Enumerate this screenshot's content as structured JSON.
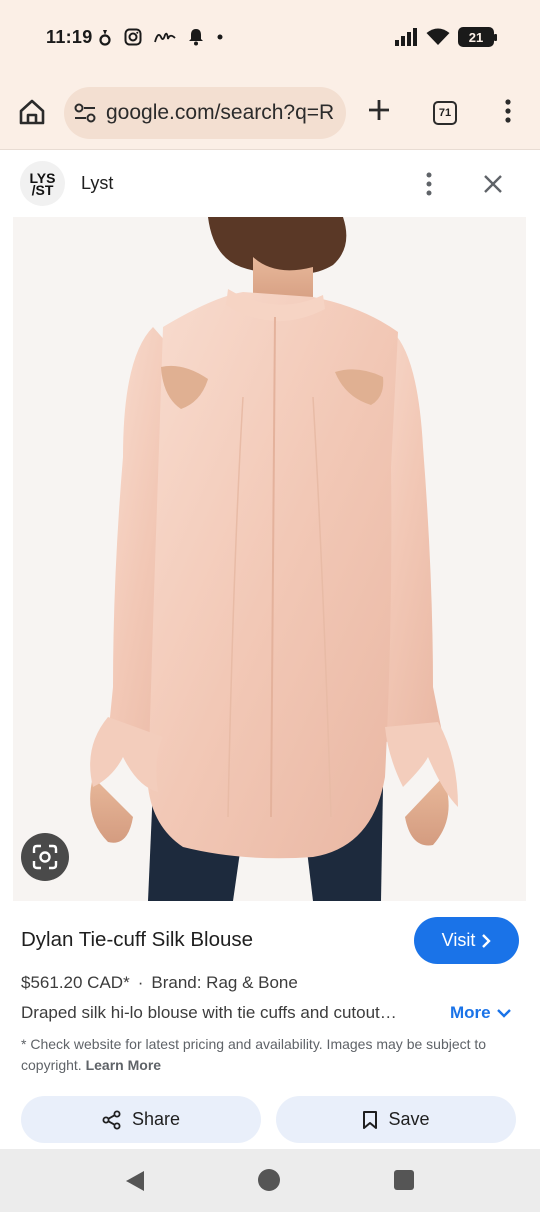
{
  "status_bar": {
    "time": "11:19",
    "left_icons": [
      "notification-icon",
      "instagram-icon",
      "app-icon",
      "bell-icon",
      "dot-icon"
    ],
    "right_icons": [
      "signal-icon",
      "wifi-icon"
    ],
    "battery": "21"
  },
  "toolbar": {
    "url": "google.com/search?q=R",
    "tab_count": "71"
  },
  "source": {
    "logo_line1": "LYS",
    "logo_line2": "/ST",
    "name": "Lyst"
  },
  "product": {
    "title": "Dylan Tie-cuff Silk Blouse",
    "visit_label": "Visit",
    "price": "$561.20 CAD*",
    "separator": "·",
    "brand": "Brand: Rag & Bone",
    "description": "Draped silk hi-lo blouse with tie cuffs and cutout…",
    "more_label": "More",
    "disclaimer": "* Check website for latest pricing and availability. Images may be subject to copyright.",
    "learn_more": "Learn More"
  },
  "actions": {
    "share_label": "Share",
    "save_label": "Save"
  },
  "colors": {
    "accent": "#1a73e8",
    "chrome_bg": "#fbefe6",
    "blouse": "#f4cfc0"
  }
}
